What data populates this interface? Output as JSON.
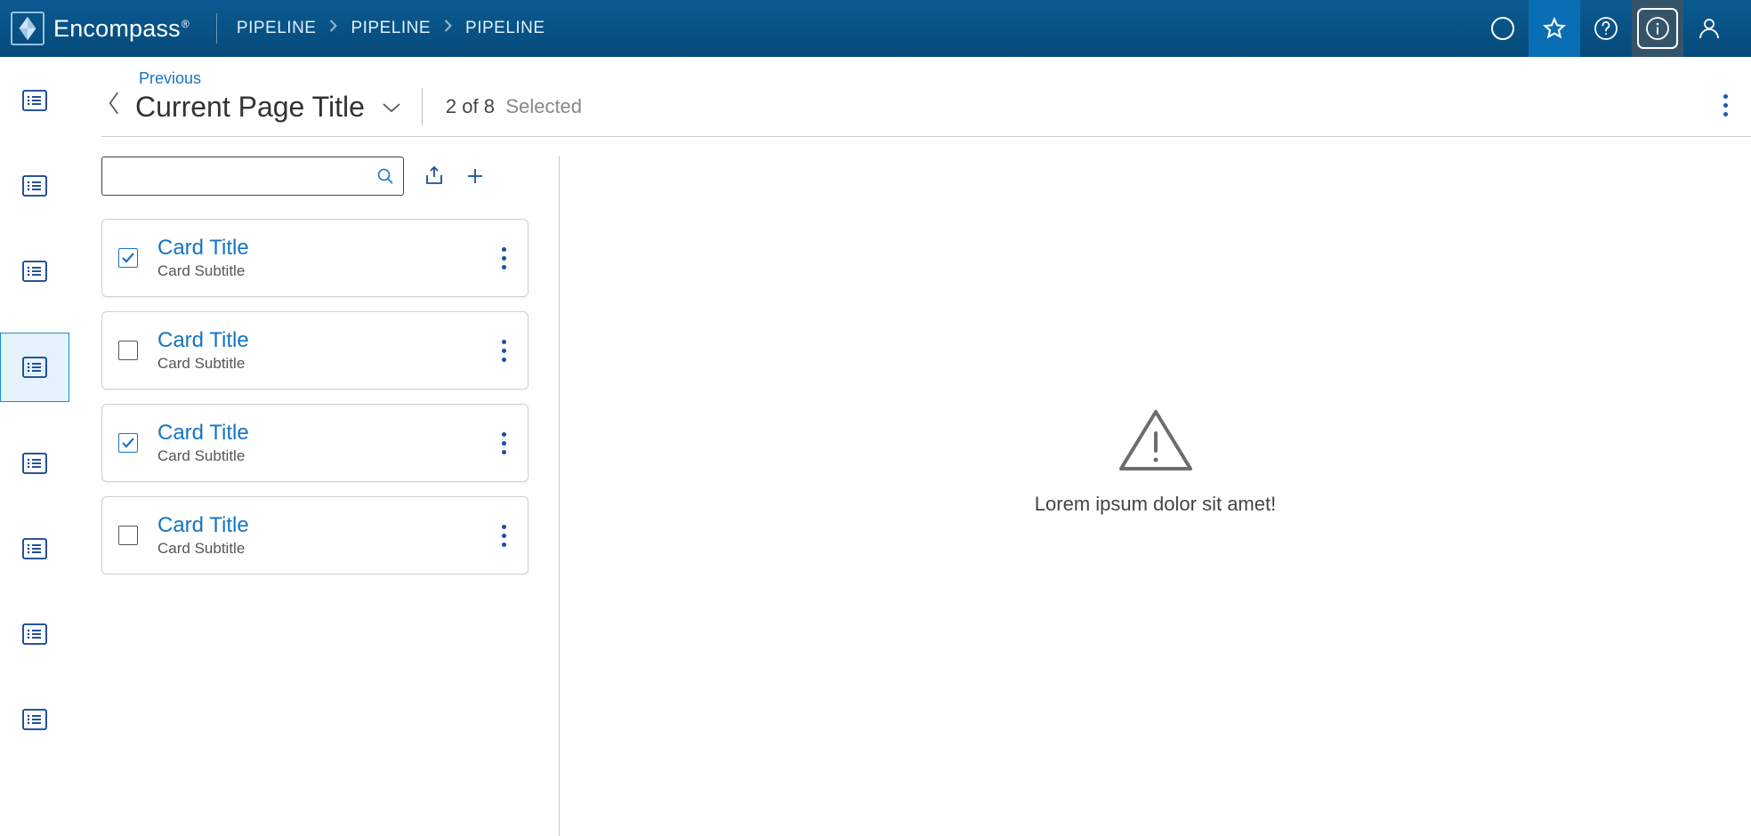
{
  "brand": {
    "name": "Encompass"
  },
  "breadcrumb": [
    "PIPELINE",
    "PIPELINE",
    "PIPELINE"
  ],
  "header": {
    "previous_label": "Previous",
    "page_title": "Current Page Title",
    "count_text": "2 of 8",
    "selected_text": "Selected"
  },
  "search": {
    "value": "",
    "placeholder": ""
  },
  "sidebar": {
    "active_index": 3,
    "items": [
      {
        "icon": "list-icon"
      },
      {
        "icon": "list-icon"
      },
      {
        "icon": "list-icon"
      },
      {
        "icon": "list-icon"
      },
      {
        "icon": "list-icon"
      },
      {
        "icon": "list-icon"
      },
      {
        "icon": "list-icon"
      },
      {
        "icon": "list-icon"
      }
    ]
  },
  "cards": [
    {
      "title": "Card Title",
      "subtitle": "Card Subtitle",
      "checked": true
    },
    {
      "title": "Card Title",
      "subtitle": "Card Subtitle",
      "checked": false
    },
    {
      "title": "Card Title",
      "subtitle": "Card Subtitle",
      "checked": true
    },
    {
      "title": "Card Title",
      "subtitle": "Card Subtitle",
      "checked": false
    }
  ],
  "detail": {
    "message": "Lorem ipsum dolor sit amet!"
  },
  "colors": {
    "primary": "#0a5a91",
    "accent": "#1474c4"
  }
}
